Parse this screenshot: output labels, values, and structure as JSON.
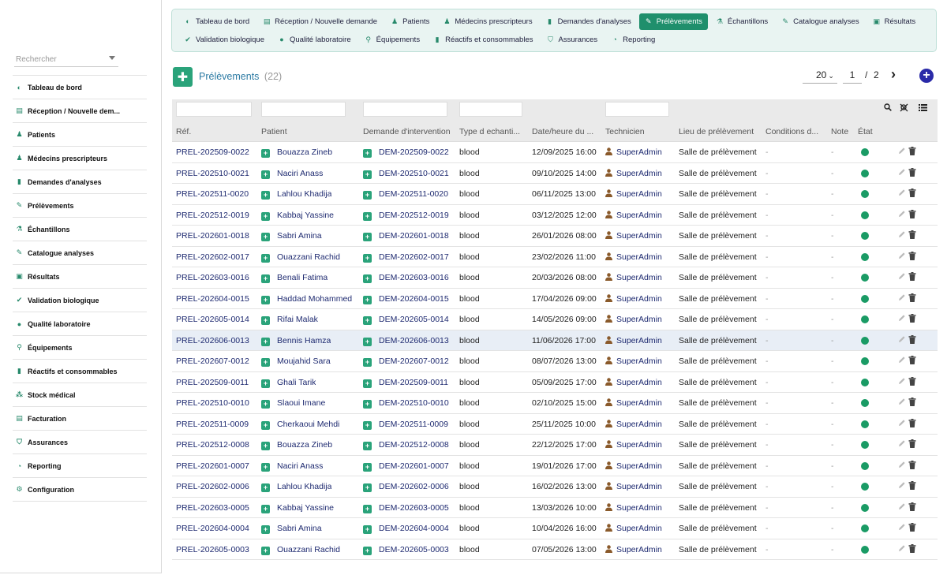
{
  "sidebar": {
    "search_placeholder": "Rechercher",
    "items": [
      {
        "label": "Tableau de bord",
        "icon": "dashboard-icon"
      },
      {
        "label": "Réception / Nouvelle dem...",
        "icon": "clipboard-icon"
      },
      {
        "label": "Patients",
        "icon": "user-icon"
      },
      {
        "label": "Médecins prescripteurs",
        "icon": "doctor-icon"
      },
      {
        "label": "Demandes d'analyses",
        "icon": "file-icon"
      },
      {
        "label": "Prélèvements",
        "icon": "syringe-icon"
      },
      {
        "label": "Échantillons",
        "icon": "flask-icon"
      },
      {
        "label": "Catalogue analyses",
        "icon": "pencil-icon"
      },
      {
        "label": "Résultats",
        "icon": "clipboard-check-icon"
      },
      {
        "label": "Validation biologique",
        "icon": "check-double-icon"
      },
      {
        "label": "Qualité laboratoire",
        "icon": "badge-icon"
      },
      {
        "label": "Équipements",
        "icon": "microscope-icon"
      },
      {
        "label": "Réactifs et consommables",
        "icon": "bottle-icon"
      },
      {
        "label": "Stock médical",
        "icon": "boxes-icon"
      },
      {
        "label": "Facturation",
        "icon": "invoice-icon"
      },
      {
        "label": "Assurances",
        "icon": "shield-icon"
      },
      {
        "label": "Reporting",
        "icon": "chart-pie-icon"
      },
      {
        "label": "Configuration",
        "icon": "gear-icon"
      }
    ]
  },
  "topnav": {
    "row1": [
      {
        "label": "Tableau de bord",
        "icon": "dashboard-icon",
        "active": false
      },
      {
        "label": "Réception / Nouvelle demande",
        "icon": "clipboard-icon",
        "active": false
      },
      {
        "label": "Patients",
        "icon": "user-icon",
        "active": false
      },
      {
        "label": "Médecins prescripteurs",
        "icon": "doctor-icon",
        "active": false
      },
      {
        "label": "Demandes d'analyses",
        "icon": "file-icon",
        "active": false
      },
      {
        "label": "Prélèvements",
        "icon": "syringe-icon",
        "active": true
      },
      {
        "label": "Échantillons",
        "icon": "flask-icon",
        "active": false
      },
      {
        "label": "Catalogue analyses",
        "icon": "pencil-icon",
        "active": false
      },
      {
        "label": "Résultats",
        "icon": "clipboard-check-icon",
        "active": false
      }
    ],
    "row2": [
      {
        "label": "Validation biologique",
        "icon": "check-double-icon",
        "active": false
      },
      {
        "label": "Qualité laboratoire",
        "icon": "badge-icon",
        "active": false
      },
      {
        "label": "Équipements",
        "icon": "microscope-icon",
        "active": false
      },
      {
        "label": "Réactifs et consommables",
        "icon": "bottle-icon",
        "active": false
      },
      {
        "label": "Assurances",
        "icon": "shield-icon",
        "active": false
      },
      {
        "label": "Reporting",
        "icon": "chart-pie-icon",
        "active": false
      }
    ]
  },
  "page": {
    "title": "Prélèvements",
    "count": "(22)",
    "per_page": "20",
    "page_current": "1",
    "page_sep": "/",
    "page_total": "2"
  },
  "table": {
    "columns": [
      "Réf.",
      "Patient",
      "Demande d'intervention",
      "Type d echanti...",
      "Date/heure du ...",
      "Technicien",
      "Lieu de prélèvement",
      "Conditions d...",
      "Note",
      "État"
    ],
    "rows": [
      {
        "ref": "PREL-202509-0022",
        "patient": "Bouazza Zineb",
        "demande": "DEM-202509-0022",
        "type": "blood",
        "date": "12/09/2025 16:00",
        "tech": "SuperAdmin",
        "lieu": "Salle de prélèvement",
        "cond": "-",
        "note": "-"
      },
      {
        "ref": "PREL-202510-0021",
        "patient": "Naciri Anass",
        "demande": "DEM-202510-0021",
        "type": "blood",
        "date": "09/10/2025 14:00",
        "tech": "SuperAdmin",
        "lieu": "Salle de prélèvement",
        "cond": "-",
        "note": "-"
      },
      {
        "ref": "PREL-202511-0020",
        "patient": "Lahlou Khadija",
        "demande": "DEM-202511-0020",
        "type": "blood",
        "date": "06/11/2025 13:00",
        "tech": "SuperAdmin",
        "lieu": "Salle de prélèvement",
        "cond": "-",
        "note": "-"
      },
      {
        "ref": "PREL-202512-0019",
        "patient": "Kabbaj Yassine",
        "demande": "DEM-202512-0019",
        "type": "blood",
        "date": "03/12/2025 12:00",
        "tech": "SuperAdmin",
        "lieu": "Salle de prélèvement",
        "cond": "-",
        "note": "-"
      },
      {
        "ref": "PREL-202601-0018",
        "patient": "Sabri Amina",
        "demande": "DEM-202601-0018",
        "type": "blood",
        "date": "26/01/2026 08:00",
        "tech": "SuperAdmin",
        "lieu": "Salle de prélèvement",
        "cond": "-",
        "note": "-"
      },
      {
        "ref": "PREL-202602-0017",
        "patient": "Ouazzani Rachid",
        "demande": "DEM-202602-0017",
        "type": "blood",
        "date": "23/02/2026 11:00",
        "tech": "SuperAdmin",
        "lieu": "Salle de prélèvement",
        "cond": "-",
        "note": "-"
      },
      {
        "ref": "PREL-202603-0016",
        "patient": "Benali Fatima",
        "demande": "DEM-202603-0016",
        "type": "blood",
        "date": "20/03/2026 08:00",
        "tech": "SuperAdmin",
        "lieu": "Salle de prélèvement",
        "cond": "-",
        "note": "-"
      },
      {
        "ref": "PREL-202604-0015",
        "patient": "Haddad Mohammed",
        "demande": "DEM-202604-0015",
        "type": "blood",
        "date": "17/04/2026 09:00",
        "tech": "SuperAdmin",
        "lieu": "Salle de prélèvement",
        "cond": "-",
        "note": "-"
      },
      {
        "ref": "PREL-202605-0014",
        "patient": "Rifai Malak",
        "demande": "DEM-202605-0014",
        "type": "blood",
        "date": "14/05/2026 09:00",
        "tech": "SuperAdmin",
        "lieu": "Salle de prélèvement",
        "cond": "-",
        "note": "-"
      },
      {
        "ref": "PREL-202606-0013",
        "patient": "Bennis Hamza",
        "demande": "DEM-202606-0013",
        "type": "blood",
        "date": "11/06/2026 17:00",
        "tech": "SuperAdmin",
        "lieu": "Salle de prélèvement",
        "cond": "-",
        "note": "-",
        "highlight": true
      },
      {
        "ref": "PREL-202607-0012",
        "patient": "Moujahid Sara",
        "demande": "DEM-202607-0012",
        "type": "blood",
        "date": "08/07/2026 13:00",
        "tech": "SuperAdmin",
        "lieu": "Salle de prélèvement",
        "cond": "-",
        "note": "-"
      },
      {
        "ref": "PREL-202509-0011",
        "patient": "Ghali Tarik",
        "demande": "DEM-202509-0011",
        "type": "blood",
        "date": "05/09/2025 17:00",
        "tech": "SuperAdmin",
        "lieu": "Salle de prélèvement",
        "cond": "-",
        "note": "-"
      },
      {
        "ref": "PREL-202510-0010",
        "patient": "Slaoui Imane",
        "demande": "DEM-202510-0010",
        "type": "blood",
        "date": "02/10/2025 15:00",
        "tech": "SuperAdmin",
        "lieu": "Salle de prélèvement",
        "cond": "-",
        "note": "-"
      },
      {
        "ref": "PREL-202511-0009",
        "patient": "Cherkaoui Mehdi",
        "demande": "DEM-202511-0009",
        "type": "blood",
        "date": "25/11/2025 10:00",
        "tech": "SuperAdmin",
        "lieu": "Salle de prélèvement",
        "cond": "-",
        "note": "-"
      },
      {
        "ref": "PREL-202512-0008",
        "patient": "Bouazza Zineb",
        "demande": "DEM-202512-0008",
        "type": "blood",
        "date": "22/12/2025 17:00",
        "tech": "SuperAdmin",
        "lieu": "Salle de prélèvement",
        "cond": "-",
        "note": "-"
      },
      {
        "ref": "PREL-202601-0007",
        "patient": "Naciri Anass",
        "demande": "DEM-202601-0007",
        "type": "blood",
        "date": "19/01/2026 17:00",
        "tech": "SuperAdmin",
        "lieu": "Salle de prélèvement",
        "cond": "-",
        "note": "-"
      },
      {
        "ref": "PREL-202602-0006",
        "patient": "Lahlou Khadija",
        "demande": "DEM-202602-0006",
        "type": "blood",
        "date": "16/02/2026 13:00",
        "tech": "SuperAdmin",
        "lieu": "Salle de prélèvement",
        "cond": "-",
        "note": "-"
      },
      {
        "ref": "PREL-202603-0005",
        "patient": "Kabbaj Yassine",
        "demande": "DEM-202603-0005",
        "type": "blood",
        "date": "13/03/2026 10:00",
        "tech": "SuperAdmin",
        "lieu": "Salle de prélèvement",
        "cond": "-",
        "note": "-"
      },
      {
        "ref": "PREL-202604-0004",
        "patient": "Sabri Amina",
        "demande": "DEM-202604-0004",
        "type": "blood",
        "date": "10/04/2026 16:00",
        "tech": "SuperAdmin",
        "lieu": "Salle de prélèvement",
        "cond": "-",
        "note": "-"
      },
      {
        "ref": "PREL-202605-0003",
        "patient": "Ouazzani Rachid",
        "demande": "DEM-202605-0003",
        "type": "blood",
        "date": "07/05/2026 13:00",
        "tech": "SuperAdmin",
        "lieu": "Salle de prélèvement",
        "cond": "-",
        "note": "-"
      }
    ]
  },
  "colors": {
    "accent": "#1f8f6c",
    "link": "#1e2a70",
    "status_ok": "#1a9b65",
    "title": "#2b7aa3"
  }
}
